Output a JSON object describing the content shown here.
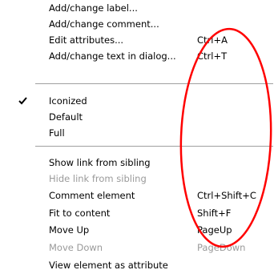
{
  "menu": {
    "groups": [
      {
        "items": [
          {
            "label": "Add/change label...",
            "shortcut": ""
          },
          {
            "label": "Add/change comment...",
            "shortcut": ""
          },
          {
            "label": "Edit attributes...",
            "shortcut": "Ctrl+A"
          },
          {
            "label": "Add/change text in dialog...",
            "shortcut": "Ctrl+T"
          }
        ]
      },
      {
        "items": [
          {
            "label": "Iconized",
            "shortcut": "",
            "checked": true
          },
          {
            "label": "Default",
            "shortcut": ""
          },
          {
            "label": "Full",
            "shortcut": ""
          }
        ]
      },
      {
        "items": [
          {
            "label": "Show link from sibling",
            "shortcut": ""
          },
          {
            "label": "Hide link from sibling",
            "shortcut": "",
            "disabled": true
          },
          {
            "label": "Comment element",
            "shortcut": "Ctrl+Shift+C"
          },
          {
            "label": "Fit to content",
            "shortcut": "Shift+F"
          },
          {
            "label": "Move Up",
            "shortcut": "PageUp"
          },
          {
            "label": "Move Down",
            "shortcut": "PageDown",
            "disabled": true
          },
          {
            "label": "View element as attribute",
            "shortcut": ""
          }
        ]
      }
    ]
  },
  "annotation": {
    "color": "#ff0000",
    "shape": "ellipse"
  }
}
